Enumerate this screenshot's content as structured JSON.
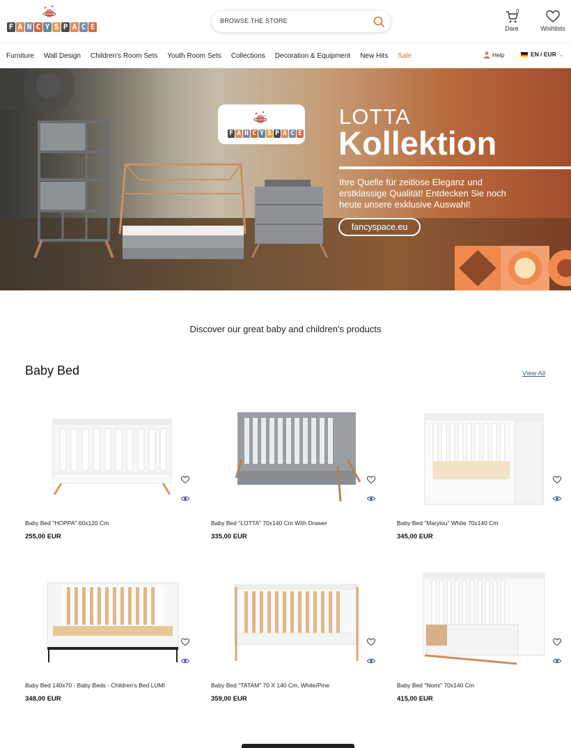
{
  "header": {
    "brand_letters": [
      "F",
      "A",
      "N",
      "C",
      "Y",
      "S",
      "P",
      "A",
      "C",
      "E"
    ],
    "search_placeholder": "BROWSE THE STORE",
    "cart": {
      "label": "Dare",
      "count": "0"
    },
    "wishlist": {
      "label": "Wishlists"
    }
  },
  "nav": {
    "items": [
      "Furniture",
      "Wall Design",
      "Children's Room Sets",
      "Youth Room Sets",
      "Collections",
      "Decoration & Equipment",
      "New Hits",
      "Sale"
    ],
    "help": "Help",
    "language": "EN / EUR"
  },
  "hero": {
    "title_line1": "LOTTA",
    "title_line2": "Kollektion",
    "text": "Ihre Quelle für zeitlose Eleganz und erstklassige Qualität! Entdecken Sie noch heute unsere exklusive Auswahl!",
    "button": "fancyspace.eu"
  },
  "discover": "Discover our great baby and children's products",
  "section": {
    "title": "Baby Bed",
    "view_all": "View All"
  },
  "products": [
    {
      "name": "Baby Bed \"HOPPA\" 60x120 Cm",
      "price": "255,00 EUR"
    },
    {
      "name": "Baby Bed \"LOTTA\" 70x140 Cm With Drawer",
      "price": "335,00 EUR"
    },
    {
      "name": "Baby Bed \"Marylou\" White 70x140 Cm",
      "price": "345,00 EUR"
    },
    {
      "name": "Baby Bed 140x70 - Baby Beds - Children's Bed LUMI",
      "price": "348,00 EUR"
    },
    {
      "name": "Baby Bed \"TATAM\" 70 X 140 Cm, White/Pine",
      "price": "359,00 EUR"
    },
    {
      "name": "Baby Bed \"Nomi\" 70x140 Cm",
      "price": "415,00 EUR"
    }
  ],
  "colors": {
    "sale": "#d4742a",
    "accent_orange": "#f08a50",
    "link": "#3a5a80"
  }
}
